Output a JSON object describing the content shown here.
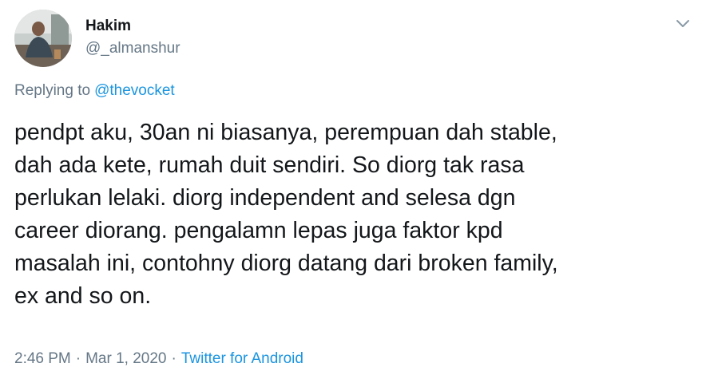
{
  "author": {
    "display_name": "Hakim",
    "handle": "@_almanshur"
  },
  "reply": {
    "prefix": "Replying to",
    "target": "@thevocket"
  },
  "tweet": {
    "text_lines": [
      "pendpt aku, 30an ni biasanya, perempuan dah stable,",
      "dah ada kete, rumah duit sendiri. So diorg tak rasa",
      "perlukan lelaki. diorg independent and selesa dgn",
      "career diorang. pengalamn lepas juga faktor kpd",
      "masalah ini, contohny diorg datang dari broken family,",
      "ex and so on."
    ]
  },
  "meta": {
    "time": "2:46 PM",
    "separator": "·",
    "date": "Mar 1, 2020",
    "source": "Twitter for Android"
  },
  "icons": {
    "menu": "chevron-down-icon",
    "avatar": "profile-photo"
  },
  "colors": {
    "text": "#14171a",
    "muted": "#657786",
    "link": "#1b95e0"
  }
}
